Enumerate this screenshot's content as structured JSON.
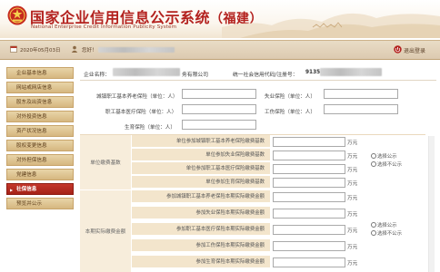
{
  "header": {
    "title_cn": "国家企业信用信息公示系统",
    "title_region": "（福建）",
    "title_en": "National Enterprise Credit Information Publicity System"
  },
  "topbar": {
    "date": "2020年05月03日",
    "notice_label": "您好！",
    "exit_label": "退出登录"
  },
  "sidebar": {
    "items": [
      {
        "label": "企业基本信息",
        "active": false
      },
      {
        "label": "网站或网店信息",
        "active": false
      },
      {
        "label": "股东及出资信息",
        "active": false
      },
      {
        "label": "对外投资信息",
        "active": false
      },
      {
        "label": "资产状况信息",
        "active": false
      },
      {
        "label": "股权变更信息",
        "active": false
      },
      {
        "label": "对外担保信息",
        "active": false
      },
      {
        "label": "党建信息",
        "active": false
      },
      {
        "label": "社保信息",
        "active": true
      },
      {
        "label": "预览并公示",
        "active": false
      }
    ]
  },
  "company": {
    "name_label": "企业名称：",
    "name_suffix": "务有限公司",
    "code_label": "统一社会信用代码/注册号：",
    "code_prefix": "9135"
  },
  "insurance": {
    "urban_pension": "城镇职工基本养老保险（单位：人）",
    "unemployment": "失业保险（单位：人）",
    "medical": "职工基本医疗保险（单位：人）",
    "injury": "工伤保险（单位：人）",
    "maternity": "生育保险（单位：人）"
  },
  "base": {
    "group_label": "单位缴费基数",
    "rows": [
      "单位参加城镇职工基本养老保险缴费基数",
      "单位参加失业保险缴费基数",
      "单位参加职工基本医疗保险缴费基数",
      "单位参加生育保险缴费基数"
    ],
    "unit": "万元"
  },
  "actual": {
    "group_label": "本期实际缴费金额",
    "rows": [
      "参加城镇职工基本养老保险本期实际缴费金额",
      "参加失业保险本期实际缴费金额",
      "参加职工基本医疗保险本期实际缴费金额",
      "参加工伤保险本期实际缴费金额",
      "参加生育保险本期实际缴费金额"
    ],
    "unit": "万元"
  },
  "publicity": {
    "option_show": "选择公示",
    "option_hide": "选择不公示"
  }
}
